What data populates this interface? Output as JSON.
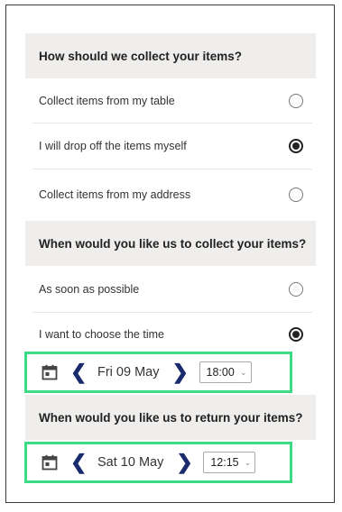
{
  "collection": {
    "question": "How should we collect your items?",
    "options": [
      {
        "label": "Collect items from my table",
        "selected": false
      },
      {
        "label": "I will drop off the items myself",
        "selected": true
      },
      {
        "label": "Collect items from my address",
        "selected": false
      }
    ]
  },
  "collect_time": {
    "question": "When would you like us to collect your items?",
    "options": [
      {
        "label": "As soon as possible",
        "selected": false
      },
      {
        "label": "I want to choose the time",
        "selected": true
      }
    ],
    "picker": {
      "icon": "calendar-icon",
      "prev": "❮",
      "date": "Fri 09 May",
      "next": "❯",
      "time": "18:00"
    }
  },
  "return_time": {
    "question": "When would you like us to return your items?",
    "picker": {
      "icon": "calendar-icon",
      "prev": "❮",
      "date": "Sat 10 May",
      "next": "❯",
      "time": "12:15"
    }
  },
  "colors": {
    "highlight": "#3ddc84",
    "arrow": "#1a2b6d",
    "header_bg": "#efeeed"
  }
}
